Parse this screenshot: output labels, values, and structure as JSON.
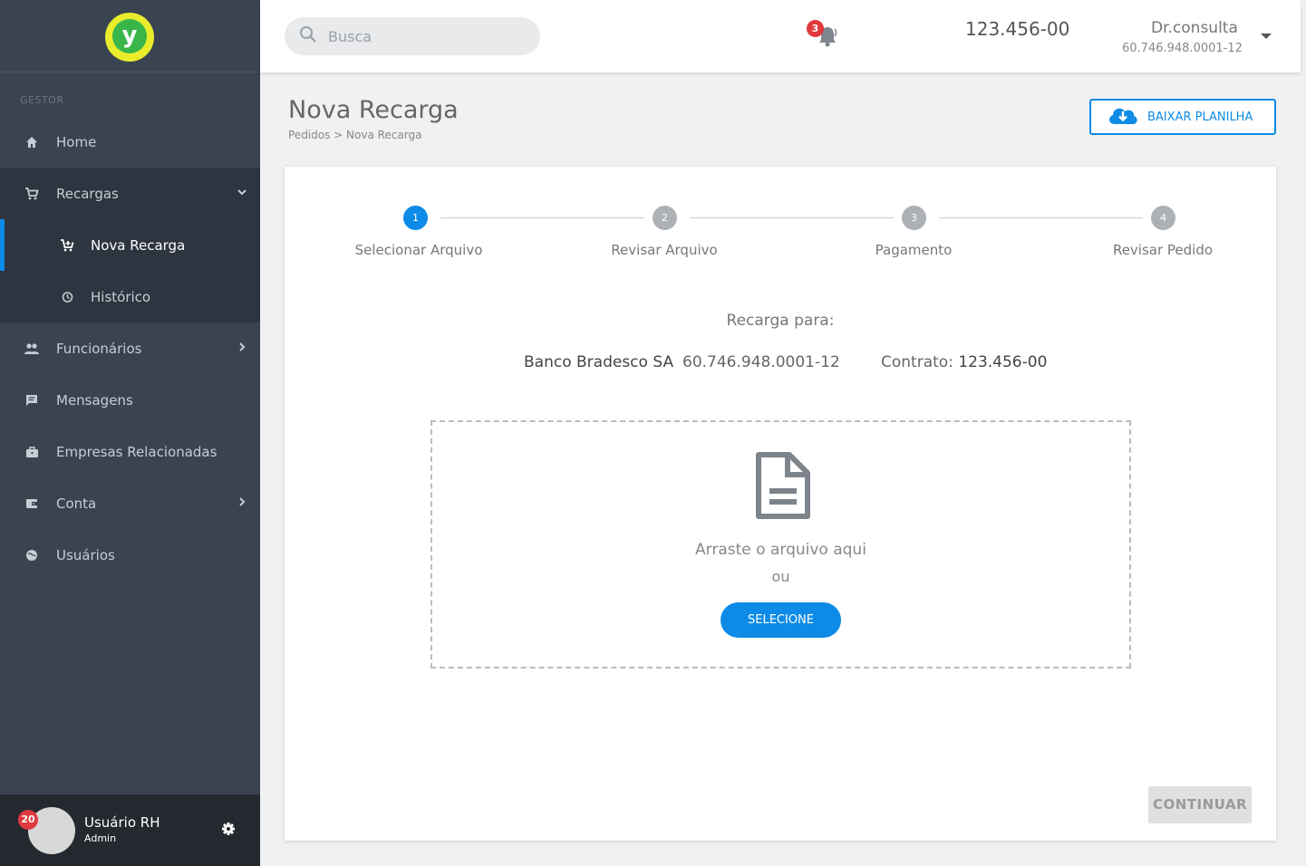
{
  "sidebar": {
    "logo_letter": "y",
    "section_label": "GESTOR",
    "items": [
      {
        "label": "Home",
        "icon": "home-icon"
      },
      {
        "label": "Recargas",
        "icon": "cart-icon"
      },
      {
        "label": "Funcionários",
        "icon": "people-icon"
      },
      {
        "label": "Mensagens",
        "icon": "message-icon"
      },
      {
        "label": "Empresas Relacionadas",
        "icon": "briefcase-icon"
      },
      {
        "label": "Conta",
        "icon": "wallet-icon"
      },
      {
        "label": "Usuários",
        "icon": "globe-icon"
      }
    ],
    "sub_items": [
      {
        "label": "Nova Recarga",
        "icon": "cart-add-icon"
      },
      {
        "label": "Histórico",
        "icon": "history-icon"
      }
    ],
    "user": {
      "name": "Usuário RH",
      "role": "Admin",
      "badge": "20"
    }
  },
  "topbar": {
    "search_placeholder": "Busca",
    "notification_count": "3",
    "contract": "123.456-00",
    "user_name": "Dr.consulta",
    "user_cnpj": "60.746.948.0001-12"
  },
  "page": {
    "title": "Nova Recarga",
    "breadcrumb": "Pedidos > Nova Recarga",
    "download_label": "BAIXAR PLANILHA"
  },
  "steps": [
    {
      "number": "1",
      "label": "Selecionar Arquivo"
    },
    {
      "number": "2",
      "label": "Revisar Arquivo"
    },
    {
      "number": "3",
      "label": "Pagamento"
    },
    {
      "number": "4",
      "label": "Revisar Pedido"
    }
  ],
  "recarga": {
    "heading": "Recarga para:",
    "company": "Banco Bradesco SA",
    "cnpj": "60.746.948.0001-12",
    "contract_label": "Contrato:",
    "contract_value": "123.456-00"
  },
  "dropzone": {
    "text": "Arraste o arquivo aqui",
    "or": "ou",
    "button": "SELECIONE"
  },
  "footer": {
    "continue": "CONTINUAR"
  },
  "colors": {
    "accent": "#0d8be6",
    "sidebar": "#3a4350",
    "badge": "#e0393e"
  }
}
